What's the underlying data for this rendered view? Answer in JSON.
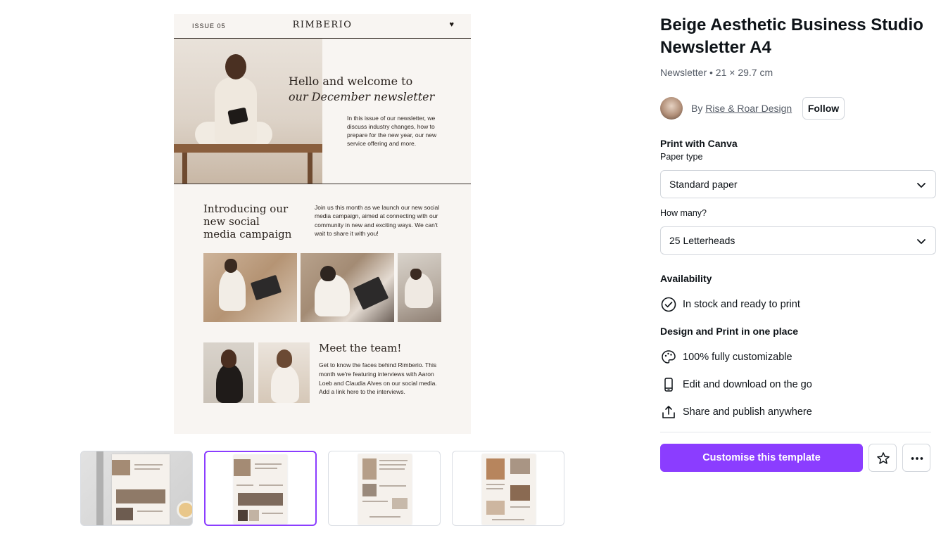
{
  "template": {
    "title": "Beige Aesthetic Business Studio Newsletter A4",
    "subtitle": "Newsletter • 21 × 29.7 cm",
    "by_prefix": "By",
    "author": "Rise & Roar Design",
    "follow_label": "Follow"
  },
  "print": {
    "heading": "Print with Canva",
    "paper_type_label": "Paper type",
    "paper_type_value": "Standard paper",
    "quantity_label": "How many?",
    "quantity_value": "25 Letterheads"
  },
  "availability": {
    "heading": "Availability",
    "status": "In stock and ready to print"
  },
  "features": {
    "heading": "Design and Print in one place",
    "items": [
      {
        "label": "100% fully customizable",
        "icon": "palette-icon"
      },
      {
        "label": "Edit and download on the go",
        "icon": "phone-icon"
      },
      {
        "label": "Share and publish anywhere",
        "icon": "share-icon"
      }
    ]
  },
  "actions": {
    "customise_label": "Customise this template",
    "star_icon": "star-icon",
    "more_icon": "more-icon"
  },
  "preview": {
    "issue": "ISSUE 05",
    "brand": "RIMBERIO",
    "heart": "♥",
    "hero_heading_line1": "Hello and welcome to",
    "hero_heading_line2": "our December newsletter",
    "hero_body": "In this issue of our newsletter, we discuss industry changes, how to prepare for the new year, our new service offering and more.",
    "campaign_heading": "Introducing our new social media campaign",
    "campaign_body": "Join us this month as we launch our new social media campaign, aimed at connecting with our community in new and exciting ways. We can't wait to share it with you!",
    "team_heading": "Meet the team!",
    "team_body": "Get to know the faces behind Rimberio. This month we're featuring interviews with Aaron Loeb and Claudia Alves on our social media. Add a link here to the interviews."
  },
  "thumbnails": {
    "count": 4,
    "selected_index": 1
  },
  "colors": {
    "accent": "#8b3dff",
    "newsletter_bg": "#f8f5f2",
    "text": "#0e1318",
    "muted": "#545b66"
  }
}
